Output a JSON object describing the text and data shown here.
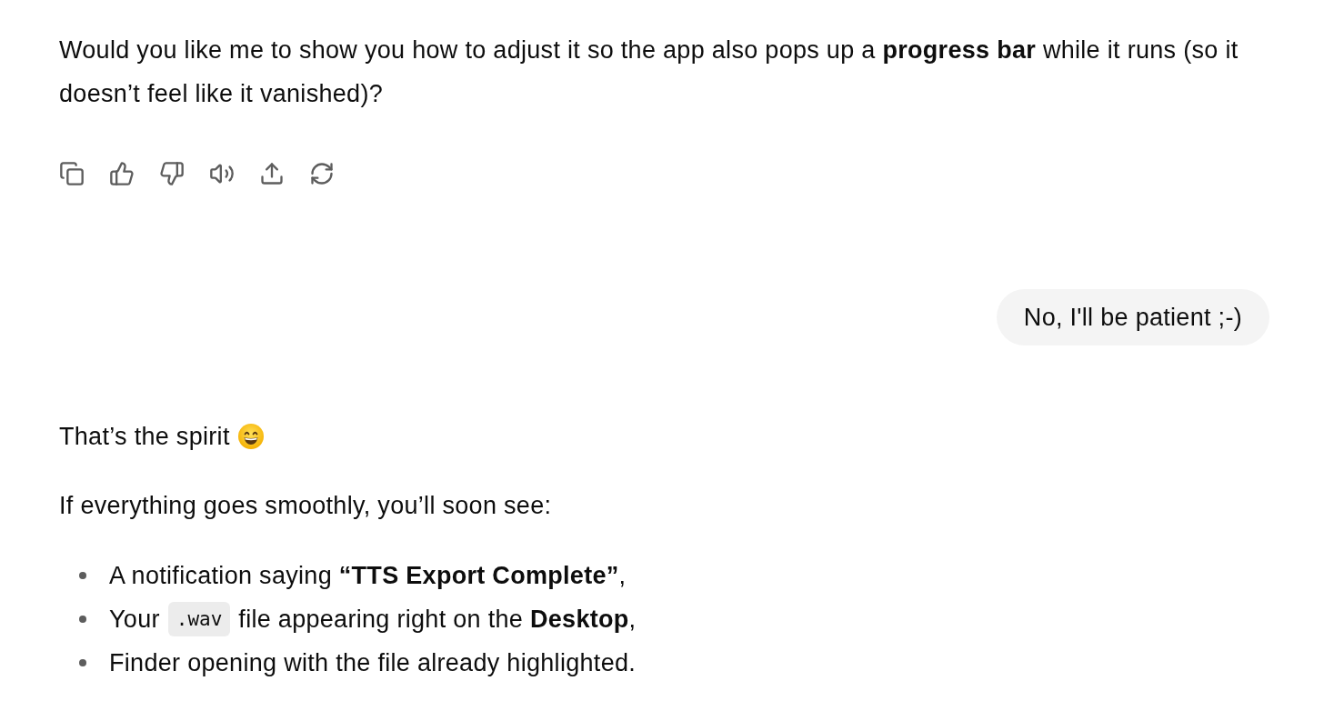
{
  "assistant_reply_1": {
    "text": "Would you like me to show you how to adjust it so the app also pops up a **progress bar** while it runs (so it doesn’t feel like it vanished)?"
  },
  "user_message": {
    "text": "No, I'll be patient ;-)"
  },
  "assistant_reply_2": {
    "greeting": "That’s the spirit",
    "lead": "If everything goes smoothly, you’ll soon see:",
    "bullets": [
      {
        "parts": [
          {
            "kind": "text",
            "text": "A notification saying **“TTS Export Complete”**,"
          }
        ]
      },
      {
        "parts": [
          {
            "kind": "text",
            "text": "Your"
          },
          {
            "kind": "code",
            "text": ".wav"
          },
          {
            "kind": "text",
            "text": "file appearing right on the **Desktop**,"
          }
        ]
      },
      {
        "parts": [
          {
            "kind": "text",
            "text": "Finder opening with the file already highlighted."
          }
        ]
      }
    ]
  }
}
